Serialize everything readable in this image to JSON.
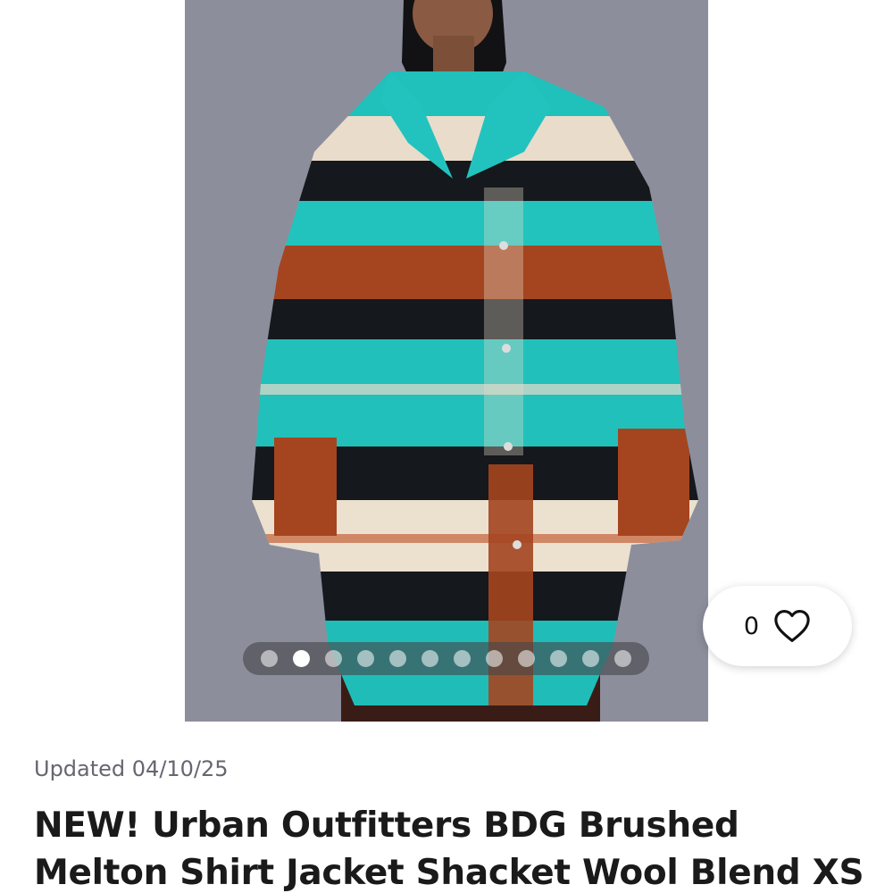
{
  "listing": {
    "updated_text": "Updated 04/10/25",
    "title": "NEW! Urban Outfitters BDG Brushed Melton Shirt Jacket Shacket Wool Blend XS"
  },
  "carousel": {
    "total_images": 12,
    "active_index": 1
  },
  "likes": {
    "count": "0",
    "icon": "heart-outline-icon"
  },
  "colors": {
    "photo_background": "#8d8e9c",
    "jacket_teal": "#1fbdb8",
    "jacket_rust": "#a4451f",
    "jacket_black": "#15181c",
    "jacket_cream": "#ece1cf"
  }
}
